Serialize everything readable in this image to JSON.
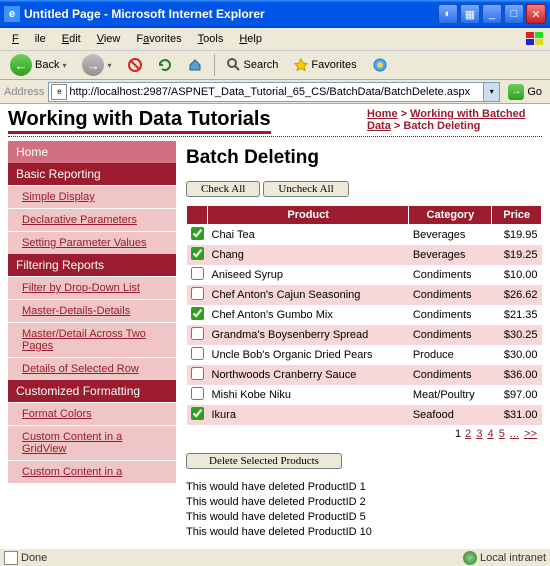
{
  "window": {
    "title": "Untitled Page - Microsoft Internet Explorer"
  },
  "menubar": {
    "file": "File",
    "edit": "Edit",
    "view": "View",
    "favorites": "Favorites",
    "tools": "Tools",
    "help": "Help"
  },
  "toolbar": {
    "back": "Back",
    "search": "Search",
    "favorites": "Favorites"
  },
  "addressbar": {
    "label": "Address",
    "url": "http://localhost:2987/ASPNET_Data_Tutorial_65_CS/BatchData/BatchDelete.aspx",
    "go": "Go"
  },
  "page": {
    "site_title": "Working with Data Tutorials",
    "breadcrumb": {
      "home": "Home",
      "sep": " > ",
      "section": "Working with Batched Data",
      "current": "Batch Deleting"
    },
    "heading": "Batch Deleting",
    "check_all": "Check All",
    "uncheck_all": "Uncheck All",
    "delete_btn": "Delete Selected Products"
  },
  "sidebar": {
    "home": "Home",
    "basic_reporting": "Basic Reporting",
    "basic_items": [
      "Simple Display",
      "Declarative Parameters",
      "Setting Parameter Values"
    ],
    "filtering": "Filtering Reports",
    "filtering_items": [
      "Filter by Drop-Down List",
      "Master-Details-Details",
      "Master/Detail Across Two Pages",
      "Details of Selected Row"
    ],
    "custom": "Customized Formatting",
    "custom_items": [
      "Format Colors",
      "Custom Content in a GridView",
      "Custom Content in a"
    ]
  },
  "grid": {
    "headers": {
      "product": "Product",
      "category": "Category",
      "price": "Price"
    },
    "rows": [
      {
        "checked": true,
        "product": "Chai Tea",
        "category": "Beverages",
        "price": "$19.95",
        "alt": false
      },
      {
        "checked": true,
        "product": "Chang",
        "category": "Beverages",
        "price": "$19.25",
        "alt": true
      },
      {
        "checked": false,
        "product": "Aniseed Syrup",
        "category": "Condiments",
        "price": "$10.00",
        "alt": false
      },
      {
        "checked": false,
        "product": "Chef Anton's Cajun Seasoning",
        "category": "Condiments",
        "price": "$26.62",
        "alt": true
      },
      {
        "checked": true,
        "product": "Chef Anton's Gumbo Mix",
        "category": "Condiments",
        "price": "$21.35",
        "alt": false
      },
      {
        "checked": false,
        "product": "Grandma's Boysenberry Spread",
        "category": "Condiments",
        "price": "$30.25",
        "alt": true
      },
      {
        "checked": false,
        "product": "Uncle Bob's Organic Dried Pears",
        "category": "Produce",
        "price": "$30.00",
        "alt": false
      },
      {
        "checked": false,
        "product": "Northwoods Cranberry Sauce",
        "category": "Condiments",
        "price": "$36.00",
        "alt": true
      },
      {
        "checked": false,
        "product": "Mishi Kobe Niku",
        "category": "Meat/Poultry",
        "price": "$97.00",
        "alt": false
      },
      {
        "checked": true,
        "product": "Ikura",
        "category": "Seafood",
        "price": "$31.00",
        "alt": true
      }
    ],
    "pager": {
      "current": "1",
      "pages": [
        "2",
        "3",
        "4",
        "5"
      ],
      "ellipsis": "...",
      "next": ">>"
    }
  },
  "results": [
    "This would have deleted ProductID 1",
    "This would have deleted ProductID 2",
    "This would have deleted ProductID 5",
    "This would have deleted ProductID 10"
  ],
  "statusbar": {
    "done": "Done",
    "zone": "Local intranet"
  }
}
